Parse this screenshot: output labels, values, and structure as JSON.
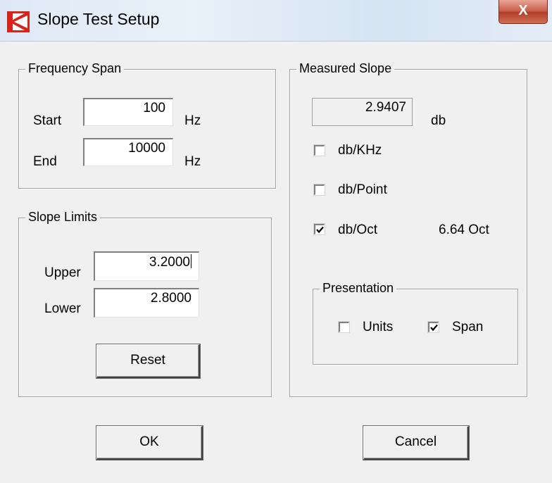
{
  "window": {
    "title": "Slope Test Setup",
    "close_glyph": "X"
  },
  "frequency_span": {
    "title": "Frequency Span",
    "start_label": "Start",
    "start_value": "100",
    "start_unit": "Hz",
    "end_label": "End",
    "end_value": "10000",
    "end_unit": "Hz"
  },
  "slope_limits": {
    "title": "Slope Limits",
    "upper_label": "Upper",
    "upper_value": "3.2000",
    "lower_label": "Lower",
    "lower_value": "2.8000",
    "reset_label": "Reset"
  },
  "measured_slope": {
    "title": "Measured Slope",
    "value": "2.9407",
    "unit": "db",
    "options": [
      {
        "label": "db/KHz",
        "checked": false
      },
      {
        "label": "db/Point",
        "checked": false
      },
      {
        "label": "db/Oct",
        "checked": true,
        "note": "6.64 Oct"
      }
    ],
    "presentation": {
      "title": "Presentation",
      "units_label": "Units",
      "units_checked": false,
      "span_label": "Span",
      "span_checked": true
    }
  },
  "footer": {
    "ok_label": "OK",
    "cancel_label": "Cancel"
  },
  "icons": {
    "app": "app-logo-icon",
    "close": "close-icon",
    "check": "check-icon"
  },
  "colors": {
    "logo_red": "#d6241a",
    "close_red": "#c75a45",
    "dialog_bg": "#f0f0f0"
  }
}
